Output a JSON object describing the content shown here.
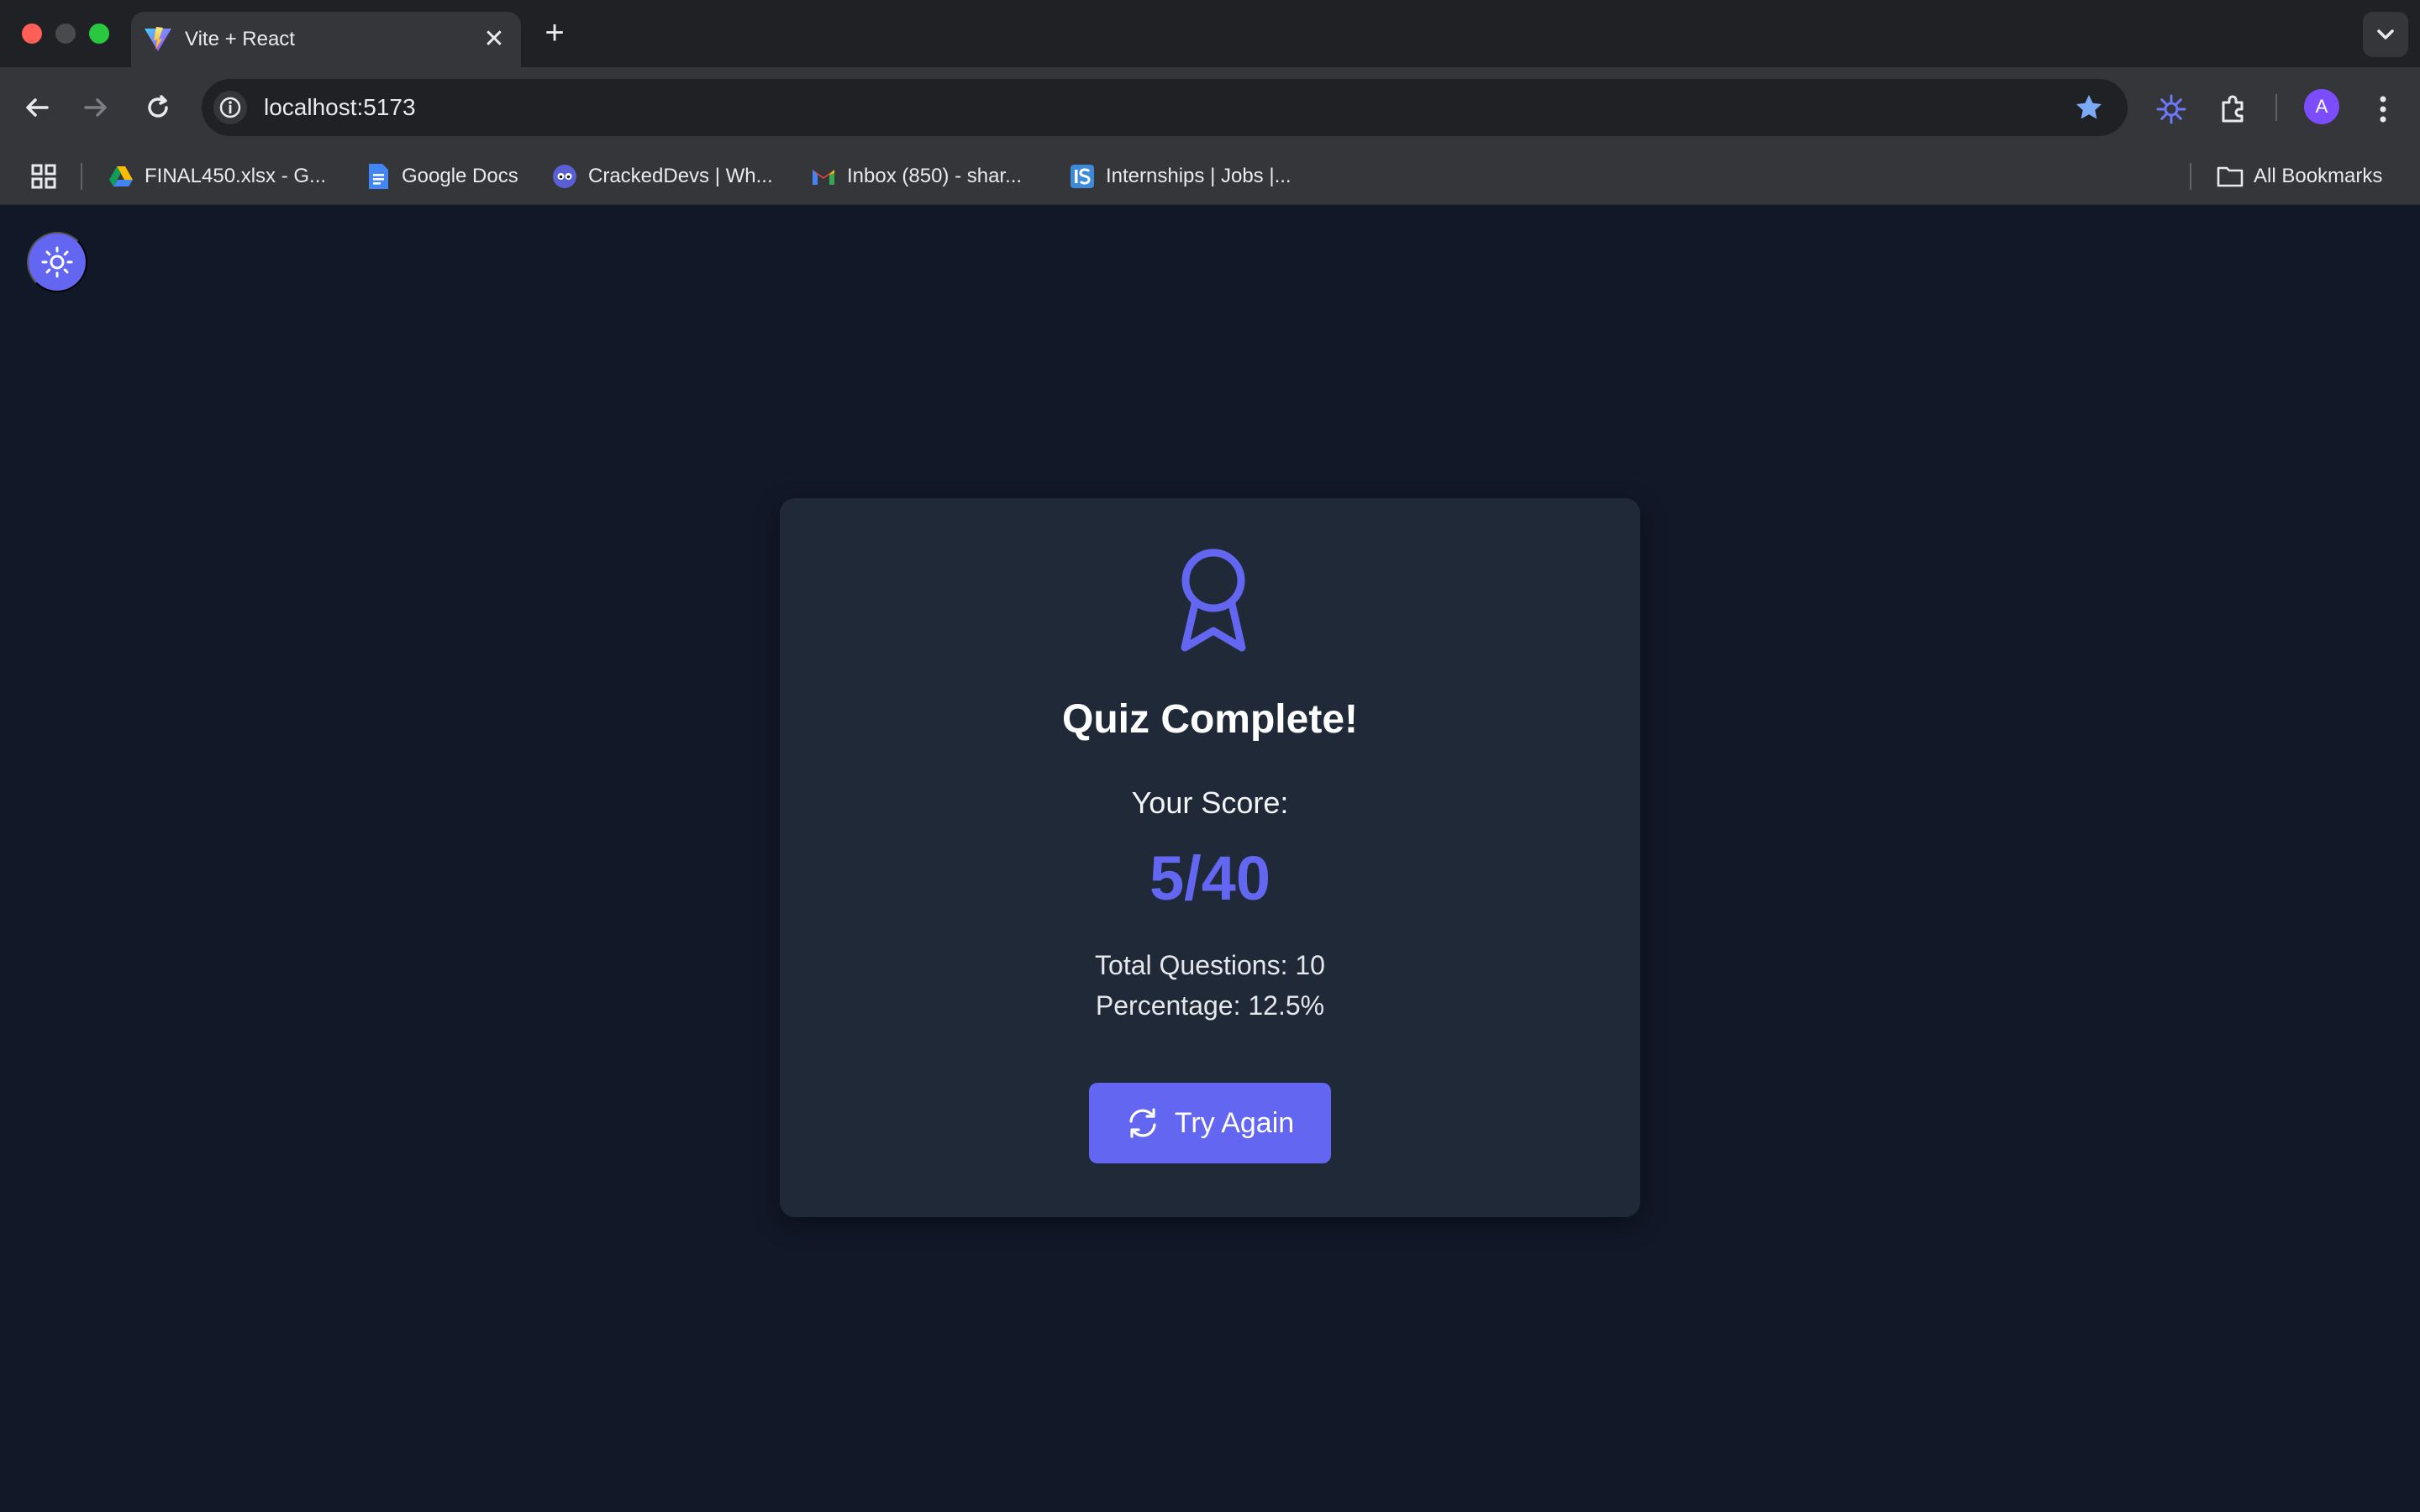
{
  "browser": {
    "tab_title": "Vite + React",
    "tab_close": "✕",
    "new_tab": "+",
    "url": "localhost:5173",
    "profile_initial": "A",
    "bookmarks": [
      {
        "label": "FINAL450.xlsx - G..."
      },
      {
        "label": "Google Docs"
      },
      {
        "label": "CrackedDevs | Wh..."
      },
      {
        "label": "Inbox (850) - shar..."
      },
      {
        "label": "Internships | Jobs |..."
      }
    ],
    "all_bookmarks": "All Bookmarks"
  },
  "quiz": {
    "title": "Quiz Complete!",
    "score_label": "Your Score:",
    "score_value": "5/40",
    "total_questions": "Total Questions: 10",
    "percentage": "Percentage: 12.5%",
    "try_again_label": "Try Again"
  },
  "colors": {
    "accent": "#6366f1",
    "page_bg": "#111827",
    "card_bg": "#1f2937"
  },
  "icons": {
    "theme_toggle": "sun-icon",
    "result": "award-icon",
    "retry": "refresh-icon"
  }
}
